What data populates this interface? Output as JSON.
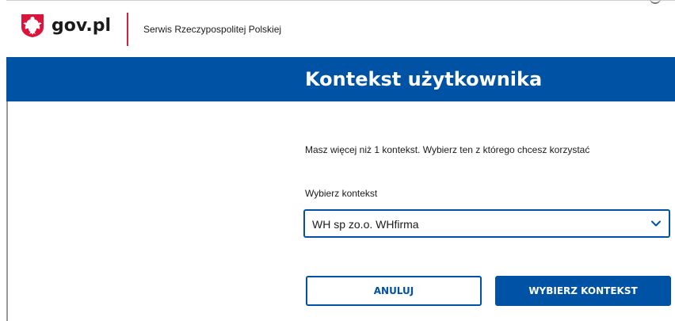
{
  "header": {
    "logo_text": "gov.pl",
    "service_name": "Serwis Rzeczypospolitej Polskiej"
  },
  "banner": {
    "title": "Kontekst użytkownika"
  },
  "form": {
    "info": "Masz więcej niż 1 kontekst. Wybierz ten z którego chcesz korzystać",
    "select_label": "Wybierz kontekst",
    "select_value": "WH sp zo.o. WHfirma"
  },
  "buttons": {
    "cancel": "ANULUJ",
    "choose": "WYBIERZ KONTEKST"
  },
  "icons": {
    "logo": "polish-eagle-icon",
    "dropdown": "chevron-down-icon"
  },
  "colors": {
    "primary": "#0052a5",
    "accent_red": "#d4213d",
    "emblem_red": "#dc143c"
  }
}
